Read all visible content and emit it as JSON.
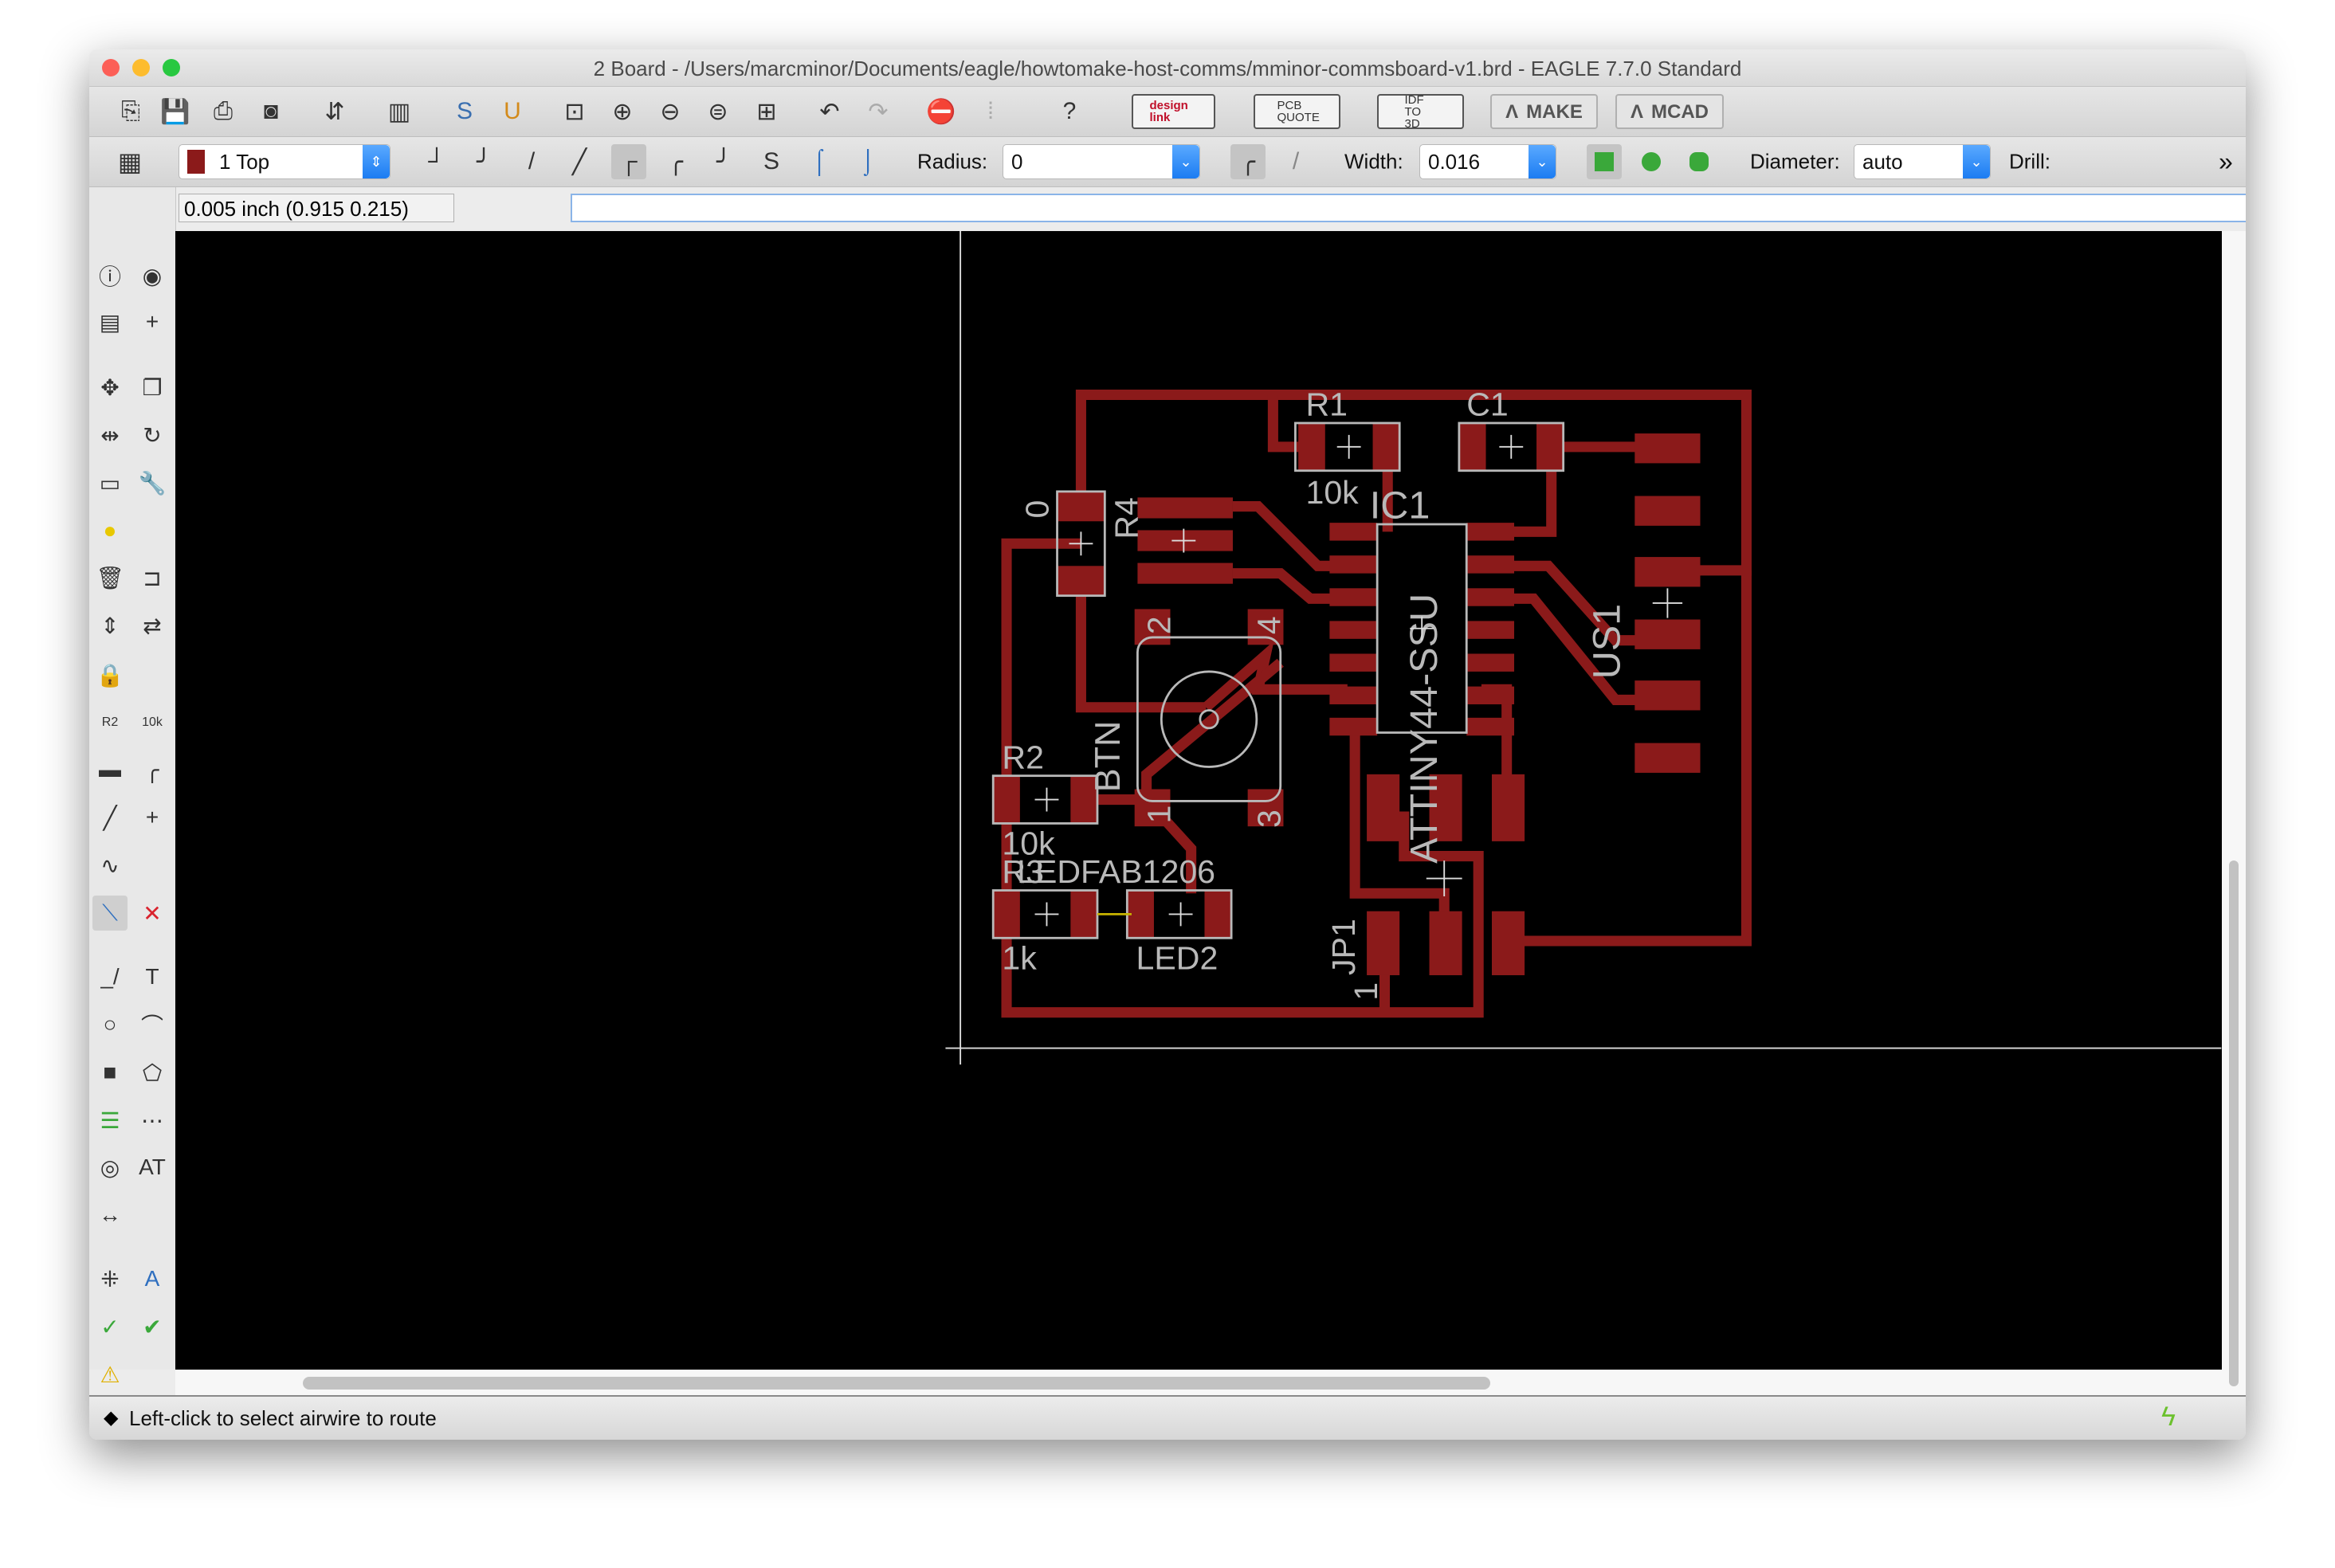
{
  "window": {
    "title": "2 Board - /Users/marcminor/Documents/eagle/howtomake-host-comms/mminor-commsboard-v1.brd - EAGLE 7.7.0 Standard",
    "traffic_lights": {
      "close": "#fc5f57",
      "minimize": "#fdbc2e",
      "zoom": "#28c840"
    }
  },
  "toolbar": {
    "icons": [
      "open-icon",
      "save-icon",
      "print-icon",
      "cam-processor-icon",
      "board-schematic-switch-icon",
      "library-icon",
      "script-icon",
      "ulp-icon",
      "zoom-fit-icon",
      "zoom-in-icon",
      "zoom-out-icon",
      "zoom-redraw-icon",
      "zoom-select-icon",
      "undo-icon",
      "redo-icon",
      "stop-icon",
      "go-icon",
      "help-icon"
    ],
    "buttons": {
      "design_link": "design link",
      "pcb_quote": "PCB QUOTE",
      "idf_to_3d": "IDF TO 3D",
      "make": "MAKE",
      "mcad": "MCAD"
    }
  },
  "parameters": {
    "layer": {
      "value": "1 Top",
      "color": "#8b1a1a"
    },
    "wire_bends": [
      "bend-90-icon",
      "bend-45-icon",
      "bend-straight-icon",
      "bend-45-alt-icon",
      "bend-90-alt-icon",
      "bend-arc-icon",
      "bend-arc-alt-icon",
      "bend-spline-icon",
      "bend-follow-me-icon",
      "bend-follow-me-alt-icon"
    ],
    "active_bend": 4,
    "radius_label": "Radius:",
    "radius_value": "0",
    "width_label": "Width:",
    "width_value": "0.016",
    "diameter_label": "Diameter:",
    "diameter_value": "auto",
    "drill_label": "Drill:",
    "more": "»",
    "via_color": "#3aa83a"
  },
  "command": {
    "coordinates": "0.005 inch (0.915 0.215)",
    "input_value": ""
  },
  "left_toolbar": {
    "icons": [
      [
        "info-icon",
        "show-icon"
      ],
      [
        "display-layers-icon",
        "mark-icon"
      ],
      [
        "move-icon",
        "copy-icon"
      ],
      [
        "mirror-icon",
        "rotate-icon"
      ],
      [
        "group-icon",
        "change-icon"
      ],
      [
        "paste-icon",
        ""
      ],
      [
        "delete-icon",
        "add-icon"
      ],
      [
        "pinswap-icon",
        "replace-icon"
      ],
      [
        "lock-icon",
        ""
      ],
      [
        "name-icon",
        "value-icon"
      ],
      [
        "smash-icon",
        "miter-icon"
      ],
      [
        "split-icon",
        "optimize-icon"
      ],
      [
        "meander-icon",
        ""
      ],
      [
        "route-icon",
        "ripup-icon"
      ],
      [
        "wire-icon",
        "text-icon"
      ],
      [
        "circle-icon",
        "arc-icon"
      ],
      [
        "rect-icon",
        "polygon-icon"
      ],
      [
        "via-icon",
        "signal-icon"
      ],
      [
        "hole-icon",
        "attribute-icon"
      ],
      [
        "dimension-icon",
        ""
      ],
      [
        "ratsnest-icon",
        "autorouter-icon"
      ],
      [
        "erc-icon",
        "drc-icon"
      ],
      [
        "errors-icon",
        ""
      ]
    ],
    "active": "route-icon"
  },
  "pcb": {
    "trace_color": "#8b1a1a",
    "silk_color": "#b9b9b9",
    "labels": {
      "r1": "R1",
      "r1_value": "10k",
      "c1": "C1",
      "ic1": "IC1",
      "ic1_value": "ATTINY44-SSU",
      "r4": "R4",
      "r4_value": "0",
      "btn": "BTN",
      "btn_pin1": "1",
      "btn_pin2": "2",
      "btn_pin3": "3",
      "btn_pin4": "4",
      "r2": "R2",
      "r2_value": "10k",
      "r3": "R3",
      "r3_value": "1k",
      "led2": "LED2",
      "led2_value": "LEDFAB1206",
      "jp1": "JP1",
      "jp1_pin1": "1",
      "us1": "US1"
    }
  },
  "status": {
    "message": "Left-click to select airwire to route",
    "indicator_color": "#6cc12e"
  }
}
